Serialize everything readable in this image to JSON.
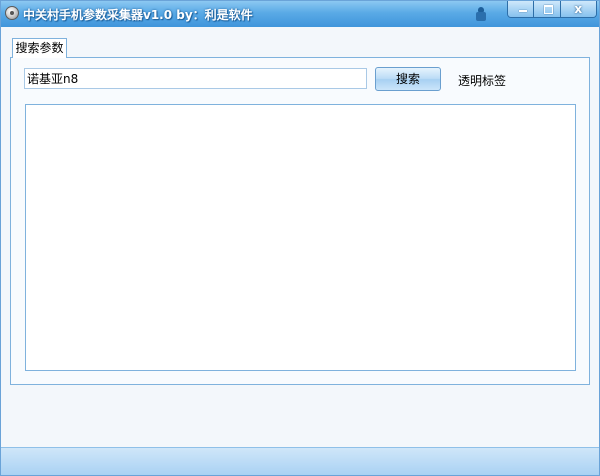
{
  "window": {
    "title": "中关村手机参数采集器v1.0   by：利是软件",
    "controls": {
      "minimize_icon": "minimize-icon",
      "maximize_icon": "maximize-icon",
      "close_icon": "close-icon",
      "close_glyph": "x"
    },
    "skin_icon": "skin-icon",
    "colors": {
      "titlebar": "#5aaae6",
      "border": "#7fb2dd",
      "background": "#f3f7fb"
    }
  },
  "tabs": [
    {
      "label": "搜索参数",
      "selected": true
    }
  ],
  "search": {
    "value": "诺基亚n8",
    "button_label": "搜索"
  },
  "label_transparent": "透明标签",
  "results": {
    "items": []
  }
}
